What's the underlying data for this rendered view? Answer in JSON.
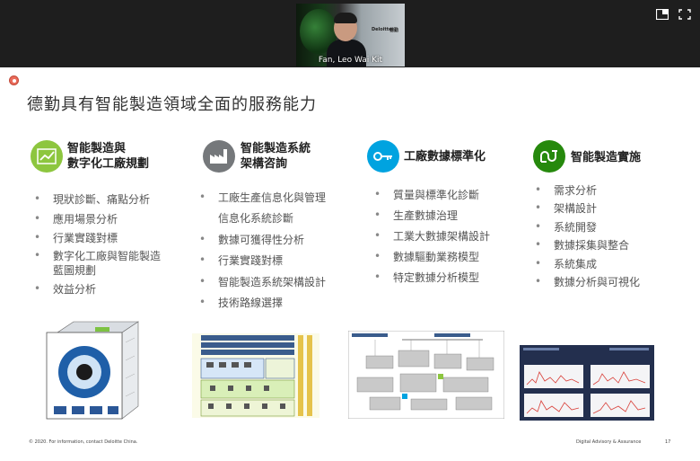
{
  "meeting": {
    "participant_name": "Fan, Leo Wai Kit",
    "video_sign_1": "Deloitte.",
    "video_sign_2": "德勤"
  },
  "toolbar": {
    "layout_icon": "layout-icon",
    "fullscreen_icon": "fullscreen-icon"
  },
  "slide": {
    "title": "德勤具有智能製造領域全面的服務能力",
    "columns": [
      {
        "icon": "line-chart-icon",
        "color": "#8dc63f",
        "heading_line1": "智能製造與",
        "heading_line2": "數字化工廠規劃",
        "bullets": [
          "現狀診斷、痛點分析",
          "應用場景分析",
          "行業實踐對標",
          "數字化工廠與智能製造",
          "藍圖規劃",
          "效益分析"
        ]
      },
      {
        "icon": "factory-icon",
        "color": "#75787b",
        "heading_line1": "智能製造系統",
        "heading_line2": "架構咨詢",
        "bullets": [
          "工廠生產信息化與管理",
          "信息化系統診斷",
          "數據可獲得性分析",
          "行業實踐對標",
          "智能製造系統架構設計",
          "技術路線選擇"
        ]
      },
      {
        "icon": "key-icon",
        "color": "#00a3e0",
        "heading_line1": "工廠數據標準化",
        "heading_line2": "",
        "bullets": [
          "質量與標準化診斷",
          "生產數據治理",
          "工業大數據架構設計",
          "數據驅動業務模型",
          "特定數據分析模型"
        ]
      },
      {
        "icon": "loop-icon",
        "color": "#26890d",
        "heading_line1": "智能製造實施",
        "heading_line2": "",
        "bullets": [
          "需求分析",
          "架構設計",
          "系統開發",
          "數據採集與整合",
          "系統集成",
          "數據分析與可視化"
        ]
      }
    ],
    "footer_left": "© 2020. For information, contact Deloitte China.",
    "footer_right": "Digital Advisory & Assurance",
    "page_number": "17"
  }
}
